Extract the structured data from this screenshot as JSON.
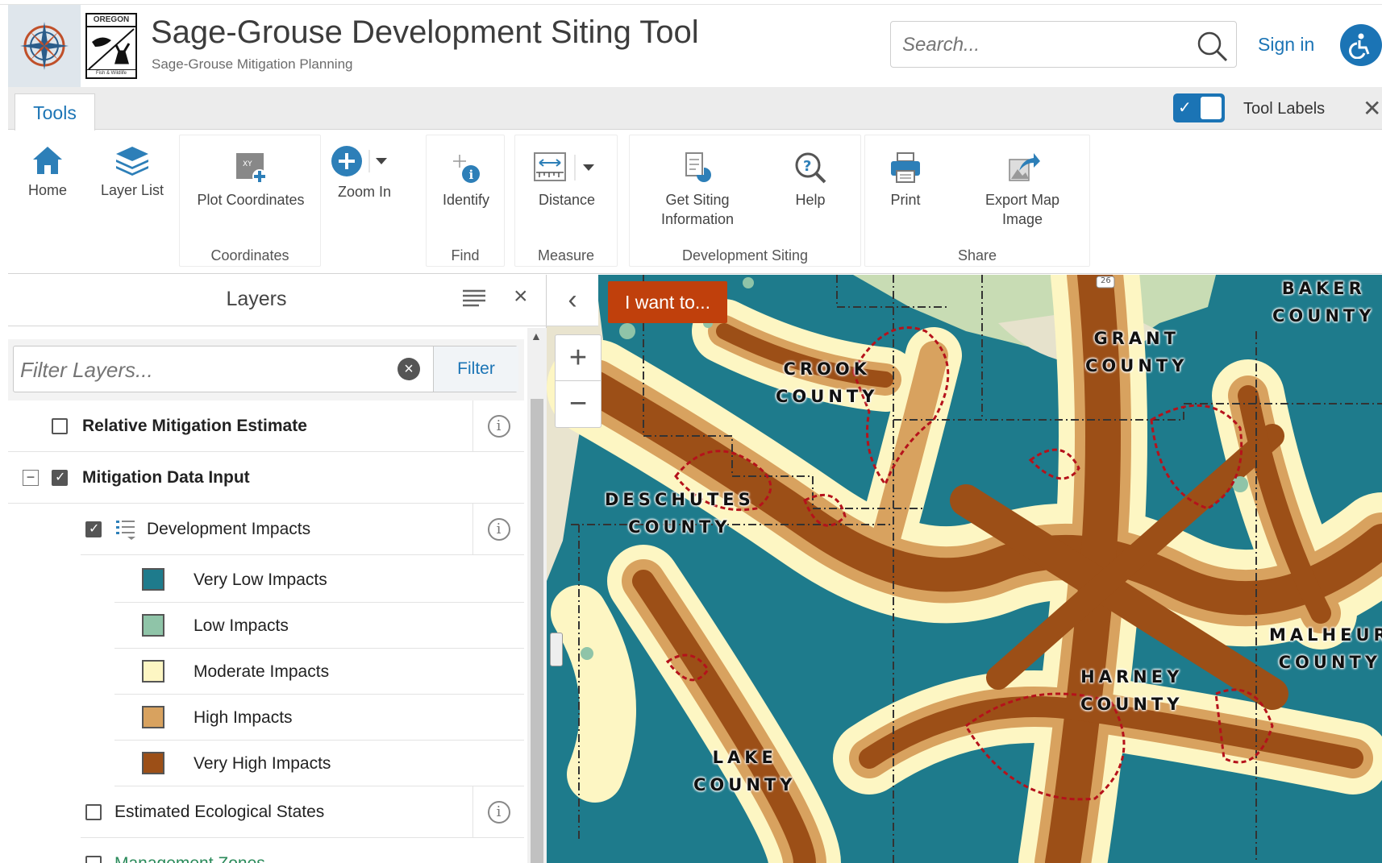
{
  "header": {
    "title": "Sage-Grouse Development Siting Tool",
    "subtitle": "Sage-Grouse Mitigation Planning",
    "logo_text_top": "OREGON",
    "logo_text_bottom": "Fish & Wildlife",
    "search_placeholder": "Search...",
    "sign_in": "Sign in"
  },
  "tabbar": {
    "tab": "Tools",
    "toggle_checked": true,
    "tool_labels": "Tool Labels",
    "close": "✕"
  },
  "ribbon": {
    "tools": {
      "home": "Home",
      "layer_list": "Layer List",
      "plot_coordinates": "Plot Coordinates",
      "zoom_in": "Zoom In",
      "identify": "Identify",
      "distance": "Distance",
      "get_siting_line1": "Get Siting",
      "get_siting_line2": "Information",
      "help": "Help",
      "print": "Print",
      "export_line1": "Export Map",
      "export_line2": "Image"
    },
    "groups": {
      "coordinates": "Coordinates",
      "find": "Find",
      "measure": "Measure",
      "development_siting": "Development Siting",
      "share": "Share"
    }
  },
  "layers_panel": {
    "title": "Layers",
    "filter_placeholder": "Filter Layers...",
    "filter_button": "Filter",
    "layers": [
      {
        "label": "Relative Mitigation Estimate",
        "checked": false
      },
      {
        "label": "Mitigation Data Input",
        "checked": true,
        "expanded": true
      },
      {
        "label": "Development Impacts",
        "checked": true
      },
      {
        "label": "Estimated Ecological States",
        "checked": false
      },
      {
        "label": "Management Zones",
        "checked": false
      }
    ],
    "legend": [
      {
        "label": "Very Low Impacts",
        "color": "#1e7b8c"
      },
      {
        "label": "Low Impacts",
        "color": "#8fc4a8"
      },
      {
        "label": "Moderate Impacts",
        "color": "#fdf6c3"
      },
      {
        "label": "High Impacts",
        "color": "#d8a25f"
      },
      {
        "label": "Very High Impacts",
        "color": "#9c4f17"
      }
    ]
  },
  "map": {
    "i_want_to": "I want to...",
    "zoom_plus": "+",
    "zoom_minus": "−",
    "highway_shield": "26",
    "counties": {
      "crook_1": "CROOK",
      "crook_2": "COUNTY",
      "grant_1": "GRANT",
      "grant_2": "COUNTY",
      "baker_1": "BAKER",
      "baker_2": "COUNTY",
      "deschutes_1": "DESCHUTES",
      "deschutes_2": "COUNTY",
      "malheur_1": "MALHEUR",
      "malheur_2": "COUNTY",
      "harney_1": "HARNEY",
      "harney_2": "COUNTY",
      "lake_1": "LAKE",
      "lake_2": "COUNTY"
    }
  }
}
